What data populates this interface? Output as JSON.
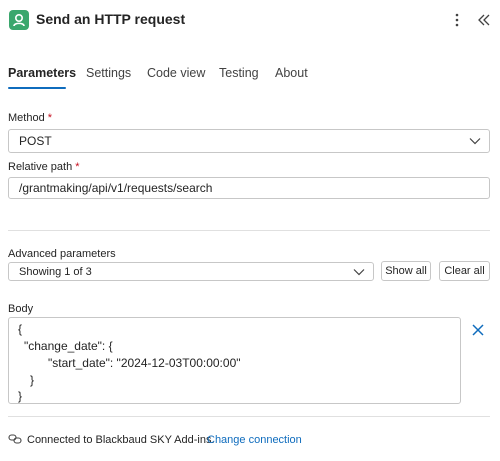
{
  "header": {
    "title": "Send an HTTP request",
    "app_icon": "blackbaud-connector-icon",
    "more_icon": "more-vertical-icon",
    "collapse_icon": "double-chevron-left-icon"
  },
  "tabs": [
    {
      "label": "Parameters",
      "active": true
    },
    {
      "label": "Settings",
      "active": false
    },
    {
      "label": "Code view",
      "active": false
    },
    {
      "label": "Testing",
      "active": false
    },
    {
      "label": "About",
      "active": false
    }
  ],
  "method": {
    "label": "Method",
    "required_mark": "*",
    "value": "POST"
  },
  "relative_path": {
    "label": "Relative path",
    "required_mark": "*",
    "value": "/grantmaking/api/v1/requests/search"
  },
  "advanced": {
    "label": "Advanced parameters",
    "value": "Showing 1 of 3",
    "show_all": "Show all",
    "clear_all": "Clear all"
  },
  "body": {
    "label": "Body",
    "lines": [
      "{",
      "\"change_date\": {",
      "\"start_date\": \"2024-12-03T00:00:00\"",
      "}",
      "}"
    ]
  },
  "footer": {
    "connection_text": "Connected to Blackbaud SKY Add-ins.",
    "change_link": "Change connection"
  },
  "colors": {
    "accent": "#0f6cbd",
    "required": "#c50f1f",
    "app_icon_bg": "#3aa76d"
  }
}
